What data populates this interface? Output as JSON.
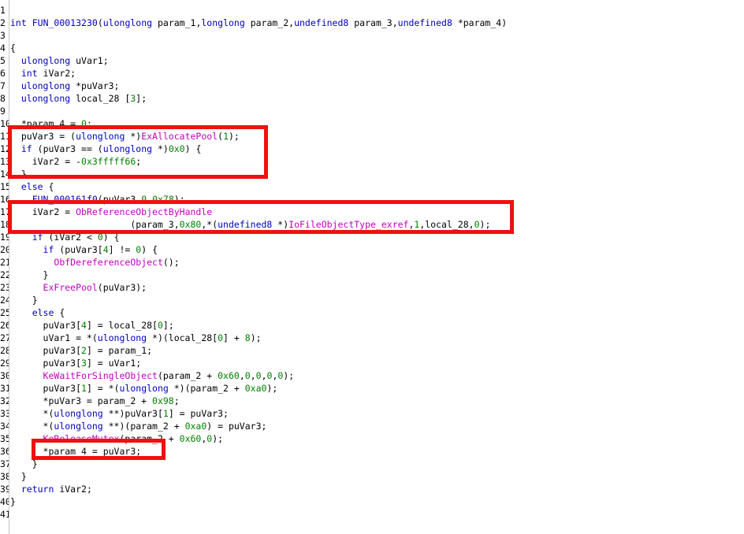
{
  "colors": {
    "keyword": "#0000c0",
    "api": "#c000c0",
    "number": "#008000",
    "annotation_box": "#ee1111"
  },
  "lines": [
    {
      "n": "1",
      "text": ""
    },
    {
      "n": "2",
      "text": "int FUN_00013230(ulonglong param_1,longlong param_2,undefined8 param_3,undefined8 *param_4)"
    },
    {
      "n": "3",
      "text": ""
    },
    {
      "n": "4",
      "text": "{"
    },
    {
      "n": "5",
      "text": "  ulonglong uVar1;"
    },
    {
      "n": "6",
      "text": "  int iVar2;"
    },
    {
      "n": "7",
      "text": "  ulonglong *puVar3;"
    },
    {
      "n": "8",
      "text": "  ulonglong local_28 [3];"
    },
    {
      "n": "9",
      "text": ""
    },
    {
      "n": "10",
      "text": "  *param_4 = 0;"
    },
    {
      "n": "11",
      "text": "  puVar3 = (ulonglong *)ExAllocatePool(1);"
    },
    {
      "n": "12",
      "text": "  if (puVar3 == (ulonglong *)0x0) {"
    },
    {
      "n": "13",
      "text": "    iVar2 = -0x3fffff66;"
    },
    {
      "n": "14",
      "text": "  }"
    },
    {
      "n": "15",
      "text": "  else {"
    },
    {
      "n": "16",
      "text": "    FUN_000161f0(puVar3,0,0x78);"
    },
    {
      "n": "17",
      "text": "    iVar2 = ObReferenceObjectByHandle"
    },
    {
      "n": "18",
      "text": "                      (param_3,0x80,*(undefined8 *)IoFileObjectType_exref,1,local_28,0);"
    },
    {
      "n": "19",
      "text": "    if (iVar2 < 0) {"
    },
    {
      "n": "20",
      "text": "      if (puVar3[4] != 0) {"
    },
    {
      "n": "21",
      "text": "        ObfDereferenceObject();"
    },
    {
      "n": "22",
      "text": "      }"
    },
    {
      "n": "23",
      "text": "      ExFreePool(puVar3);"
    },
    {
      "n": "24",
      "text": "    }"
    },
    {
      "n": "25",
      "text": "    else {"
    },
    {
      "n": "26",
      "text": "      puVar3[4] = local_28[0];"
    },
    {
      "n": "27",
      "text": "      uVar1 = *(ulonglong *)(local_28[0] + 8);"
    },
    {
      "n": "28",
      "text": "      puVar3[2] = param_1;"
    },
    {
      "n": "29",
      "text": "      puVar3[3] = uVar1;"
    },
    {
      "n": "30",
      "text": "      KeWaitForSingleObject(param_2 + 0x60,0,0,0,0);"
    },
    {
      "n": "31",
      "text": "      puVar3[1] = *(ulonglong *)(param_2 + 0xa0);"
    },
    {
      "n": "32",
      "text": "      *puVar3 = param_2 + 0x98;"
    },
    {
      "n": "33",
      "text": "      *(ulonglong **)puVar3[1] = puVar3;"
    },
    {
      "n": "34",
      "text": "      *(ulonglong **)(param_2 + 0xa0) = puVar3;"
    },
    {
      "n": "35",
      "text": "      KeReleaseMutex(param_2 + 0x60,0);"
    },
    {
      "n": "36",
      "text": "      *param_4 = puVar3;"
    },
    {
      "n": "37",
      "text": "    }"
    },
    {
      "n": "38",
      "text": "  }"
    },
    {
      "n": "39",
      "text": "  return iVar2;"
    },
    {
      "n": "40",
      "text": "}"
    },
    {
      "n": "41",
      "text": ""
    }
  ]
}
